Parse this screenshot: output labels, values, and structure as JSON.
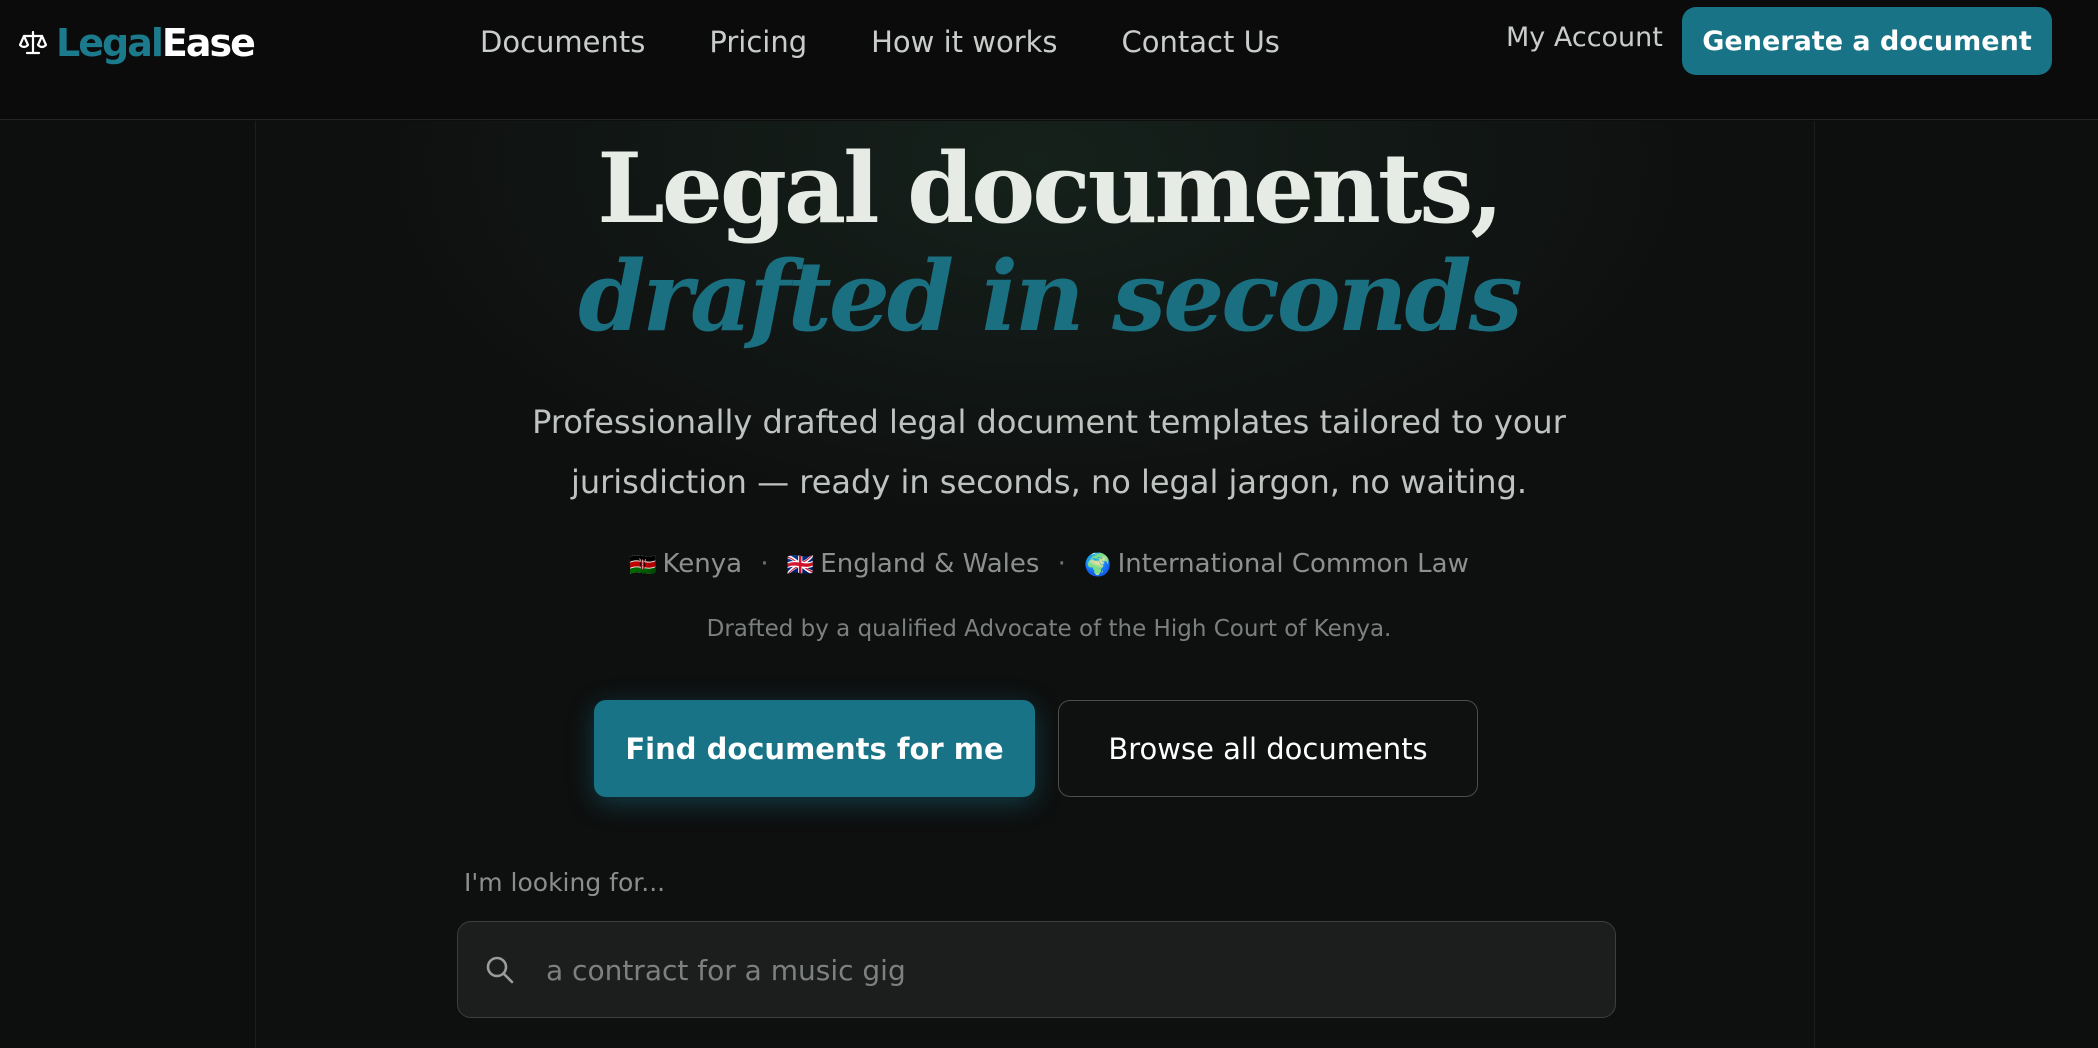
{
  "brand": {
    "logo_part1": "Legal",
    "logo_part2": "Ease",
    "logo_icon": "scales-icon"
  },
  "nav": {
    "links": [
      "Documents",
      "Pricing",
      "How it works",
      "Contact Us"
    ],
    "account": "My Account",
    "cta": "Generate a document"
  },
  "hero": {
    "headline_line1": "Legal documents,",
    "headline_line2": "drafted in seconds",
    "subtitle": "Professionally drafted legal document templates tailored to your jurisdiction — ready in seconds, no legal jargon, no waiting.",
    "jurisdictions": [
      {
        "flag": "🇰🇪",
        "name": "Kenya"
      },
      {
        "flag": "🇬🇧",
        "name": "England & Wales"
      },
      {
        "flag": "🌍",
        "name": "International Common Law"
      }
    ],
    "separator": "·",
    "drafted_by": "Drafted by a qualified Advocate of the High Court of Kenya.",
    "primary_button": "Find documents for me",
    "secondary_button": "Browse all documents"
  },
  "search": {
    "label": "I'm looking for...",
    "placeholder": "a contract for a music gig",
    "value": ""
  },
  "colors": {
    "accent": "#177385",
    "accent_text": "#1a6f80",
    "background": "#0d0e0e"
  }
}
